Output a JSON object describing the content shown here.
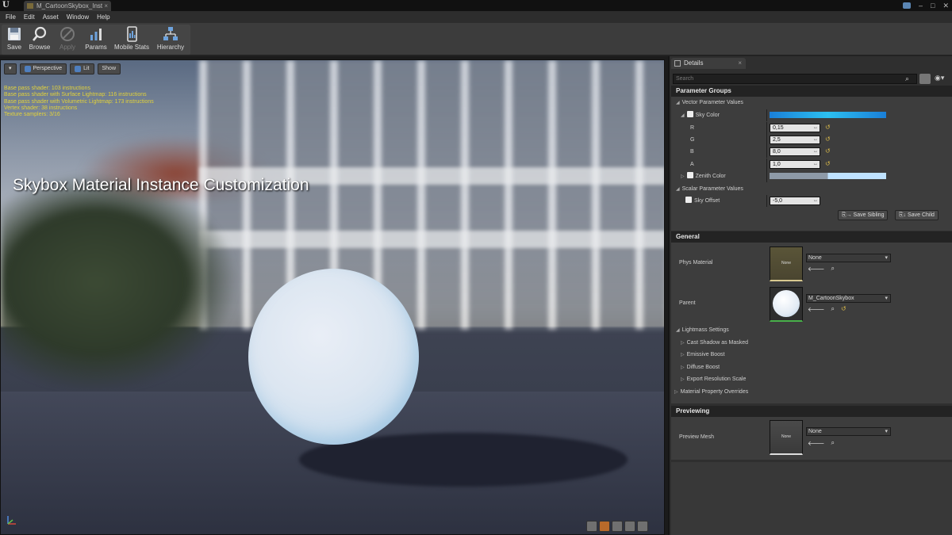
{
  "window": {
    "tab_title": "M_CartoonSkybox_Inst",
    "controls": [
      "–",
      "□",
      "✕"
    ]
  },
  "menu": [
    "File",
    "Edit",
    "Asset",
    "Window",
    "Help"
  ],
  "toolbar": {
    "save": "Save",
    "browse": "Browse",
    "apply": "Apply",
    "params": "Params",
    "mobile_stats": "Mobile Stats",
    "hierarchy": "Hierarchy"
  },
  "viewport": {
    "view_mode": "Perspective",
    "lighting": "Lit",
    "show": "Show",
    "stats": [
      "Base pass shader: 103 instructions",
      "Base pass shader with Surface Lightmap: 116 instructions",
      "Base pass shader with Volumetric Lightmap: 173 instructions",
      "Vertex shader: 38 instructions",
      "Texture samplers: 3/16"
    ],
    "overlay_title": "Skybox Material Instance Customization"
  },
  "details": {
    "tab": "Details",
    "search_placeholder": "Search",
    "parameter_groups": {
      "header": "Parameter Groups",
      "vector_header": "Vector Parameter Values",
      "sky_color_label": "Sky Color",
      "sky_color_hex": "#1ea8e8",
      "r_label": "R",
      "r_value": "0,15",
      "g_label": "G",
      "g_value": "2,5",
      "b_label": "B",
      "b_value": "8,0",
      "a_label": "A",
      "a_value": "1,0",
      "zenith_label": "Zenith Color",
      "zenith_hex": "#bfe2ff",
      "scalar_header": "Scalar Parameter Values",
      "sky_offset_label": "Sky Offset",
      "sky_offset_value": "-5,0",
      "save_sibling": "Save Sibling",
      "save_child": "Save Child"
    },
    "general": {
      "header": "General",
      "phys_material_label": "Phys Material",
      "phys_material_thumb": "None",
      "phys_material_value": "None",
      "parent_label": "Parent",
      "parent_value": "M_CartoonSkybox",
      "lightmass_label": "Lightmass Settings",
      "cast_shadow_label": "Cast Shadow as Masked",
      "emissive_boost_label": "Emissive Boost",
      "diffuse_boost_label": "Diffuse Boost",
      "export_res_label": "Export Resolution Scale",
      "overrides_label": "Material Property Overrides"
    },
    "previewing": {
      "header": "Previewing",
      "preview_mesh_label": "Preview Mesh",
      "preview_mesh_thumb": "None",
      "preview_mesh_value": "None"
    }
  }
}
